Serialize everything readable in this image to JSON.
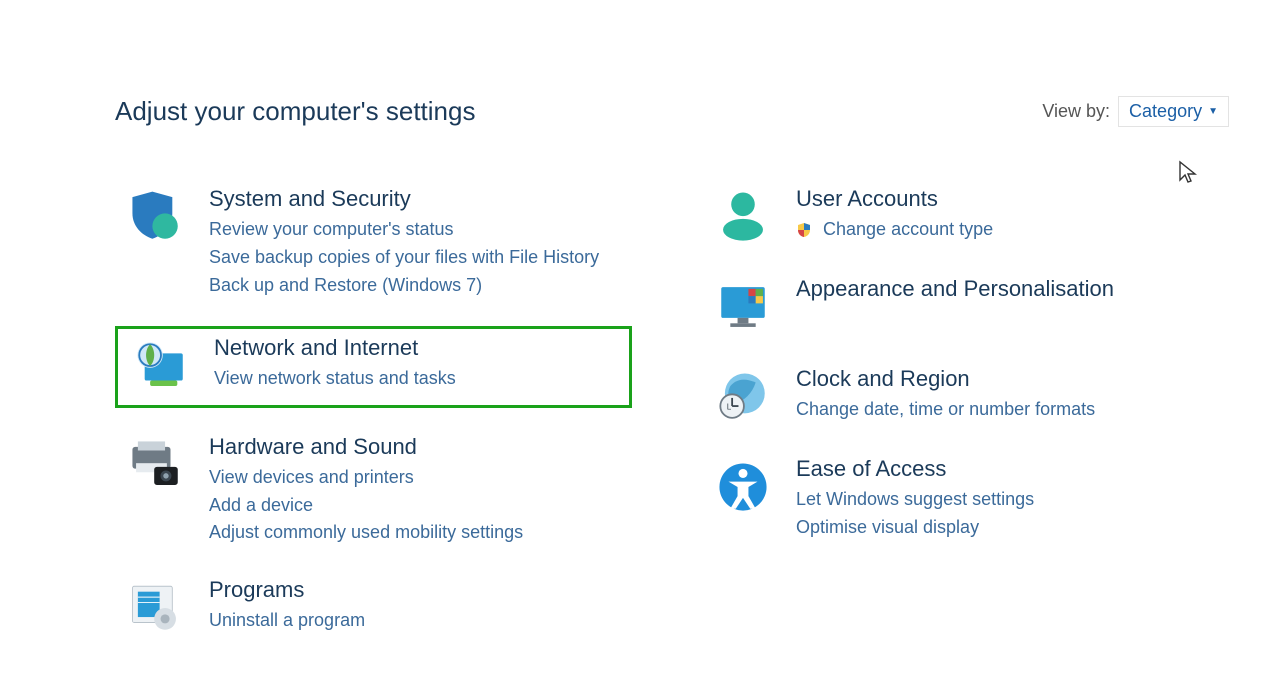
{
  "header": {
    "title": "Adjust your computer's settings",
    "viewby_label": "View by:",
    "viewby_value": "Category"
  },
  "categories": {
    "system_security": {
      "title": "System and Security",
      "links": [
        "Review your computer's status",
        "Save backup copies of your files with File History",
        "Back up and Restore (Windows 7)"
      ]
    },
    "network_internet": {
      "title": "Network and Internet",
      "links": [
        "View network status and tasks"
      ]
    },
    "hardware_sound": {
      "title": "Hardware and Sound",
      "links": [
        "View devices and printers",
        "Add a device",
        "Adjust commonly used mobility settings"
      ]
    },
    "programs": {
      "title": "Programs",
      "links": [
        "Uninstall a program"
      ]
    },
    "user_accounts": {
      "title": "User Accounts",
      "links": [
        "Change account type"
      ]
    },
    "appearance": {
      "title": "Appearance and Personalisation"
    },
    "clock_region": {
      "title": "Clock and Region",
      "links": [
        "Change date, time or number formats"
      ]
    },
    "ease_access": {
      "title": "Ease of Access",
      "links": [
        "Let Windows suggest settings",
        "Optimise visual display"
      ]
    }
  }
}
